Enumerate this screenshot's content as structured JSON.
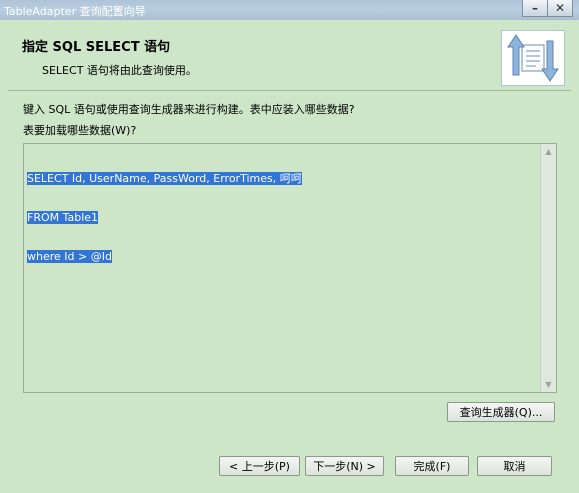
{
  "window": {
    "title": "TableAdapter 查询配置向导",
    "minimize_glyph": "–",
    "close_glyph": "✕"
  },
  "header": {
    "title": "指定 SQL SELECT 语句",
    "subtitle": "SELECT 语句将由此查询使用。"
  },
  "instructions": {
    "line1": "键入 SQL 语句或使用查询生成器来进行构建。表中应装入哪些数据?",
    "line2": "表要加载哪些数据(W)?"
  },
  "sql_editor": {
    "lines": [
      "SELECT Id, UserName, PassWord, ErrorTimes, 呵呵",
      "FROM Table1",
      "where Id > @Id"
    ]
  },
  "buttons": {
    "query_builder": "查询生成器(Q)...",
    "previous": "< 上一步(P)",
    "next": "下一步(N) >",
    "finish": "完成(F)",
    "cancel": "取消"
  },
  "colors": {
    "background": "#cde6c8",
    "selection": "#3375d7"
  }
}
